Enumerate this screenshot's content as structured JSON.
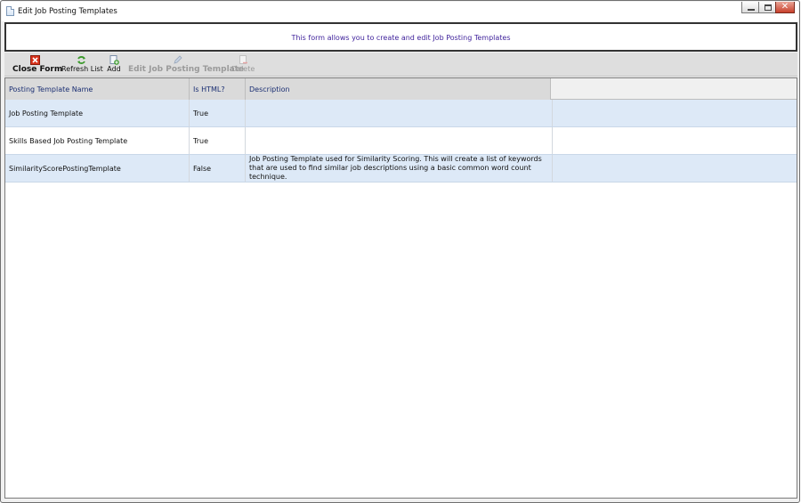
{
  "window": {
    "title": "Edit Job Posting Templates",
    "controls": {
      "minimize": "minimize",
      "maximize": "maximize",
      "close": "✕"
    }
  },
  "info": {
    "text": "This form allows you to create and edit Job Posting Templates"
  },
  "toolbar": {
    "close_form": {
      "label": "Close Form",
      "icon": "close-form-icon"
    },
    "refresh_list": {
      "label": "Refresh List",
      "icon": "refresh-icon"
    },
    "add": {
      "label": "Add",
      "icon": "add-icon"
    },
    "edit": {
      "label": "Edit Job Posting Template",
      "icon": "pencil-icon",
      "enabled": false
    },
    "delete": {
      "label": "Delete",
      "icon": "delete-icon",
      "enabled": false
    }
  },
  "grid": {
    "columns": [
      "Posting Template Name",
      "Is HTML?",
      "Description"
    ],
    "rows": [
      {
        "name": "Job Posting Template",
        "is_html": "True",
        "description": ""
      },
      {
        "name": "Skills Based Job Posting Template",
        "is_html": "True",
        "description": ""
      },
      {
        "name": "SimilarityScorePostingTemplate",
        "is_html": "False",
        "description": "Job Posting Template used for Similarity Scoring. This will create a list of keywords that are used to find similar job descriptions using a basic common word count technique."
      }
    ]
  },
  "colors": {
    "info_text": "#3d1f9a",
    "header_text": "#1b2f73",
    "row_highlight": "#dde9f7",
    "toolbar_bg": "#dedede",
    "close_button": "#c8402b"
  }
}
